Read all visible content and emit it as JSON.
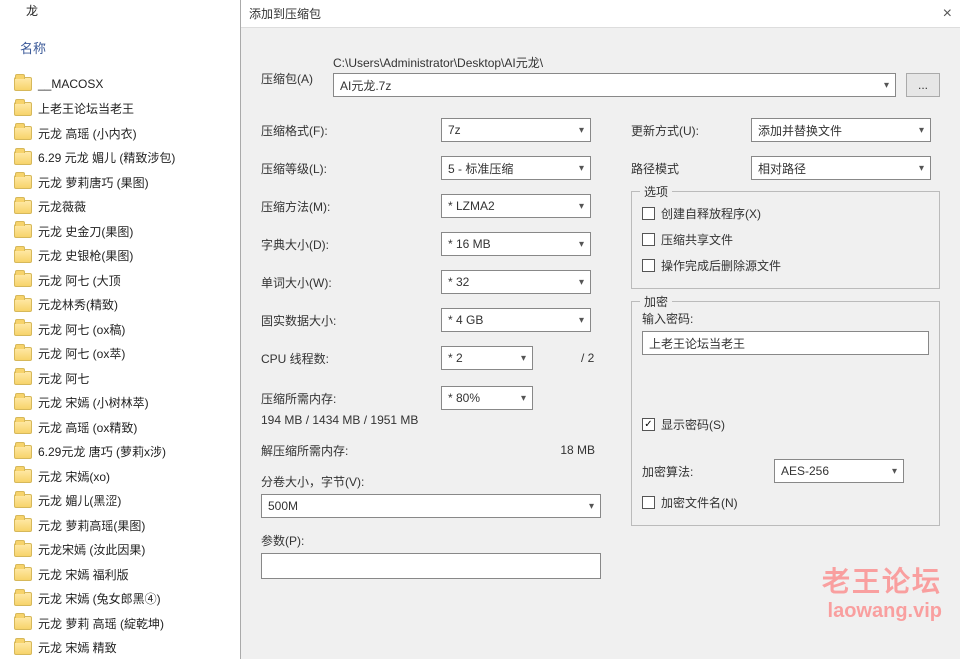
{
  "explorer": {
    "breadcrumb_tail": "龙",
    "column_header": "名称",
    "items": [
      "__MACOSX",
      "上老王论坛当老王",
      "元龙 高瑶 (小内衣)",
      "6.29 元龙   媚儿 (精致涉包)",
      "元龙   萝莉唐巧 (果图)",
      "元龙薇薇",
      "元龙   史金刀(果图)",
      "元龙   史银枪(果图)",
      "元龙  阿七  (大顶",
      "元龙林秀(精致)",
      "元龙  阿七 (ox稿)",
      "元龙  阿七 (ox萃)",
      "元龙 阿七",
      "元龙  宋嫣  (小树林萃)",
      "元龙  高瑶 (ox精致)",
      "6.29元龙   唐巧 (萝莉x涉)",
      "元龙 宋嫣(xo)",
      "元龙  媚儿(黑涩)",
      "元龙  萝莉高瑶(果图)",
      "元龙宋嫣  (汝此因果)",
      "元龙  宋嫣  福利版",
      "元龙  宋嫣 (兔女郎黑④)",
      "元龙  萝莉 高瑶  (綻乾坤)",
      "元龙   宋嫣  精致"
    ]
  },
  "dialog": {
    "title": "添加到压缩包",
    "archive": {
      "label": "压缩包(A)",
      "path_prefix": "C:\\Users\\Administrator\\Desktop\\AI元龙\\",
      "filename": "AI元龙.7z",
      "browse": "..."
    },
    "left": {
      "format": {
        "label": "压缩格式(F):",
        "value": "7z"
      },
      "level": {
        "label": "压缩等级(L):",
        "value": "5 - 标准压缩"
      },
      "method": {
        "label": "压缩方法(M):",
        "value": "* LZMA2"
      },
      "dict": {
        "label": "字典大小(D):",
        "value": "* 16 MB"
      },
      "word": {
        "label": "单词大小(W):",
        "value": "* 32"
      },
      "solid": {
        "label": "固实数据大小:",
        "value": "* 4 GB"
      },
      "threads": {
        "label": "CPU 线程数:",
        "value": "* 2",
        "of": "/ 2"
      },
      "mem_comp": {
        "label": "压缩所需内存:",
        "pct": "* 80%",
        "detail": "194 MB / 1434 MB / 1951 MB"
      },
      "mem_decomp": {
        "label": "解压缩所需内存:",
        "value": "18 MB"
      },
      "block": {
        "label": "分卷大小，字节(V):",
        "value": "500M"
      },
      "params": {
        "label": "参数(P):"
      }
    },
    "right": {
      "update": {
        "label": "更新方式(U):",
        "value": "添加并替换文件"
      },
      "path": {
        "label": "路径模式",
        "value": "相对路径"
      },
      "options_group": "选项",
      "opt_sfx": "创建自释放程序(X)",
      "opt_shared": "压缩共享文件",
      "opt_delete": "操作完成后删除源文件",
      "enc_group": "加密",
      "pwd_label": "输入密码:",
      "pwd_value": "上老王论坛当老王",
      "show_pwd": "显示密码(S)",
      "enc_method": {
        "label": "加密算法:",
        "value": "AES-256"
      },
      "enc_names": "加密文件名(N)"
    }
  },
  "watermark": {
    "line1": "老王论坛",
    "line2": "laowang.vip"
  }
}
